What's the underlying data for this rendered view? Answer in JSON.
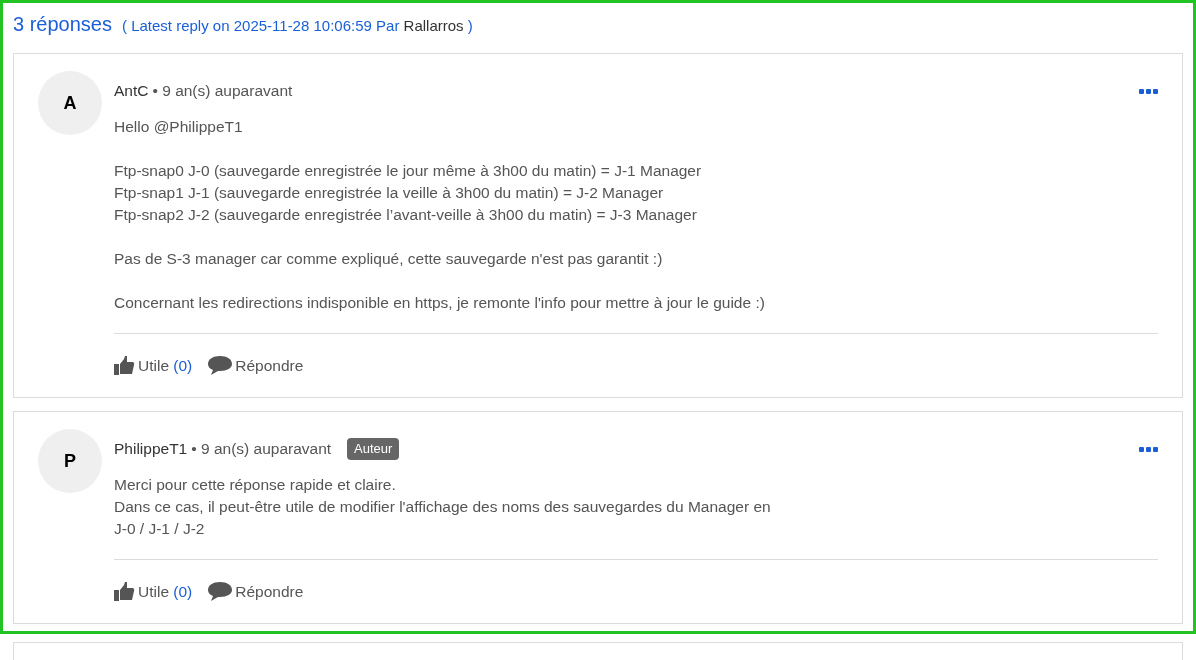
{
  "header": {
    "count": "3 réponses",
    "latest_prefix": "( Latest reply on 2025-11-28 10:06:59 Par",
    "latest_user": "Rallarros",
    "latest_suffix": ")"
  },
  "posts": [
    {
      "avatar": "A",
      "author": "AntC",
      "time": "• 9 an(s) auparavant",
      "paragraphs": [
        [
          "Hello @PhilippeT1"
        ],
        [
          "Ftp-snap0 J-0 (sauvegarde enregistrée le jour même à 3h00 du matin) = J-1 Manager",
          "Ftp-snap1 J-1 (sauvegarde enregistrée la veille à 3h00 du matin) = J-2 Manager",
          "Ftp-snap2 J-2 (sauvegarde enregistrée l’avant-veille à 3h00 du matin) = J-3 Manager"
        ],
        [
          "Pas de S-3 manager car comme expliqué, cette sauvegarde n'est pas garantit :)"
        ],
        [
          "Concernant les redirections indisponible en https, je remonte l'info pour mettre à jour le guide :)"
        ]
      ],
      "like_label": "Utile",
      "like_count": "(0)",
      "reply_label": "Répondre"
    },
    {
      "avatar": "P",
      "author": "PhilippeT1",
      "time": "• 9 an(s) auparavant",
      "badge": "Auteur",
      "paragraphs": [
        [
          "Merci pour cette réponse rapide et claire.",
          "Dans ce cas, il peut-être utile de modifier l'affichage des noms des sauvegardes du Manager en",
          "J-0 / J-1 / J-2"
        ]
      ],
      "like_label": "Utile",
      "like_count": "(0)",
      "reply_label": "Répondre"
    }
  ]
}
